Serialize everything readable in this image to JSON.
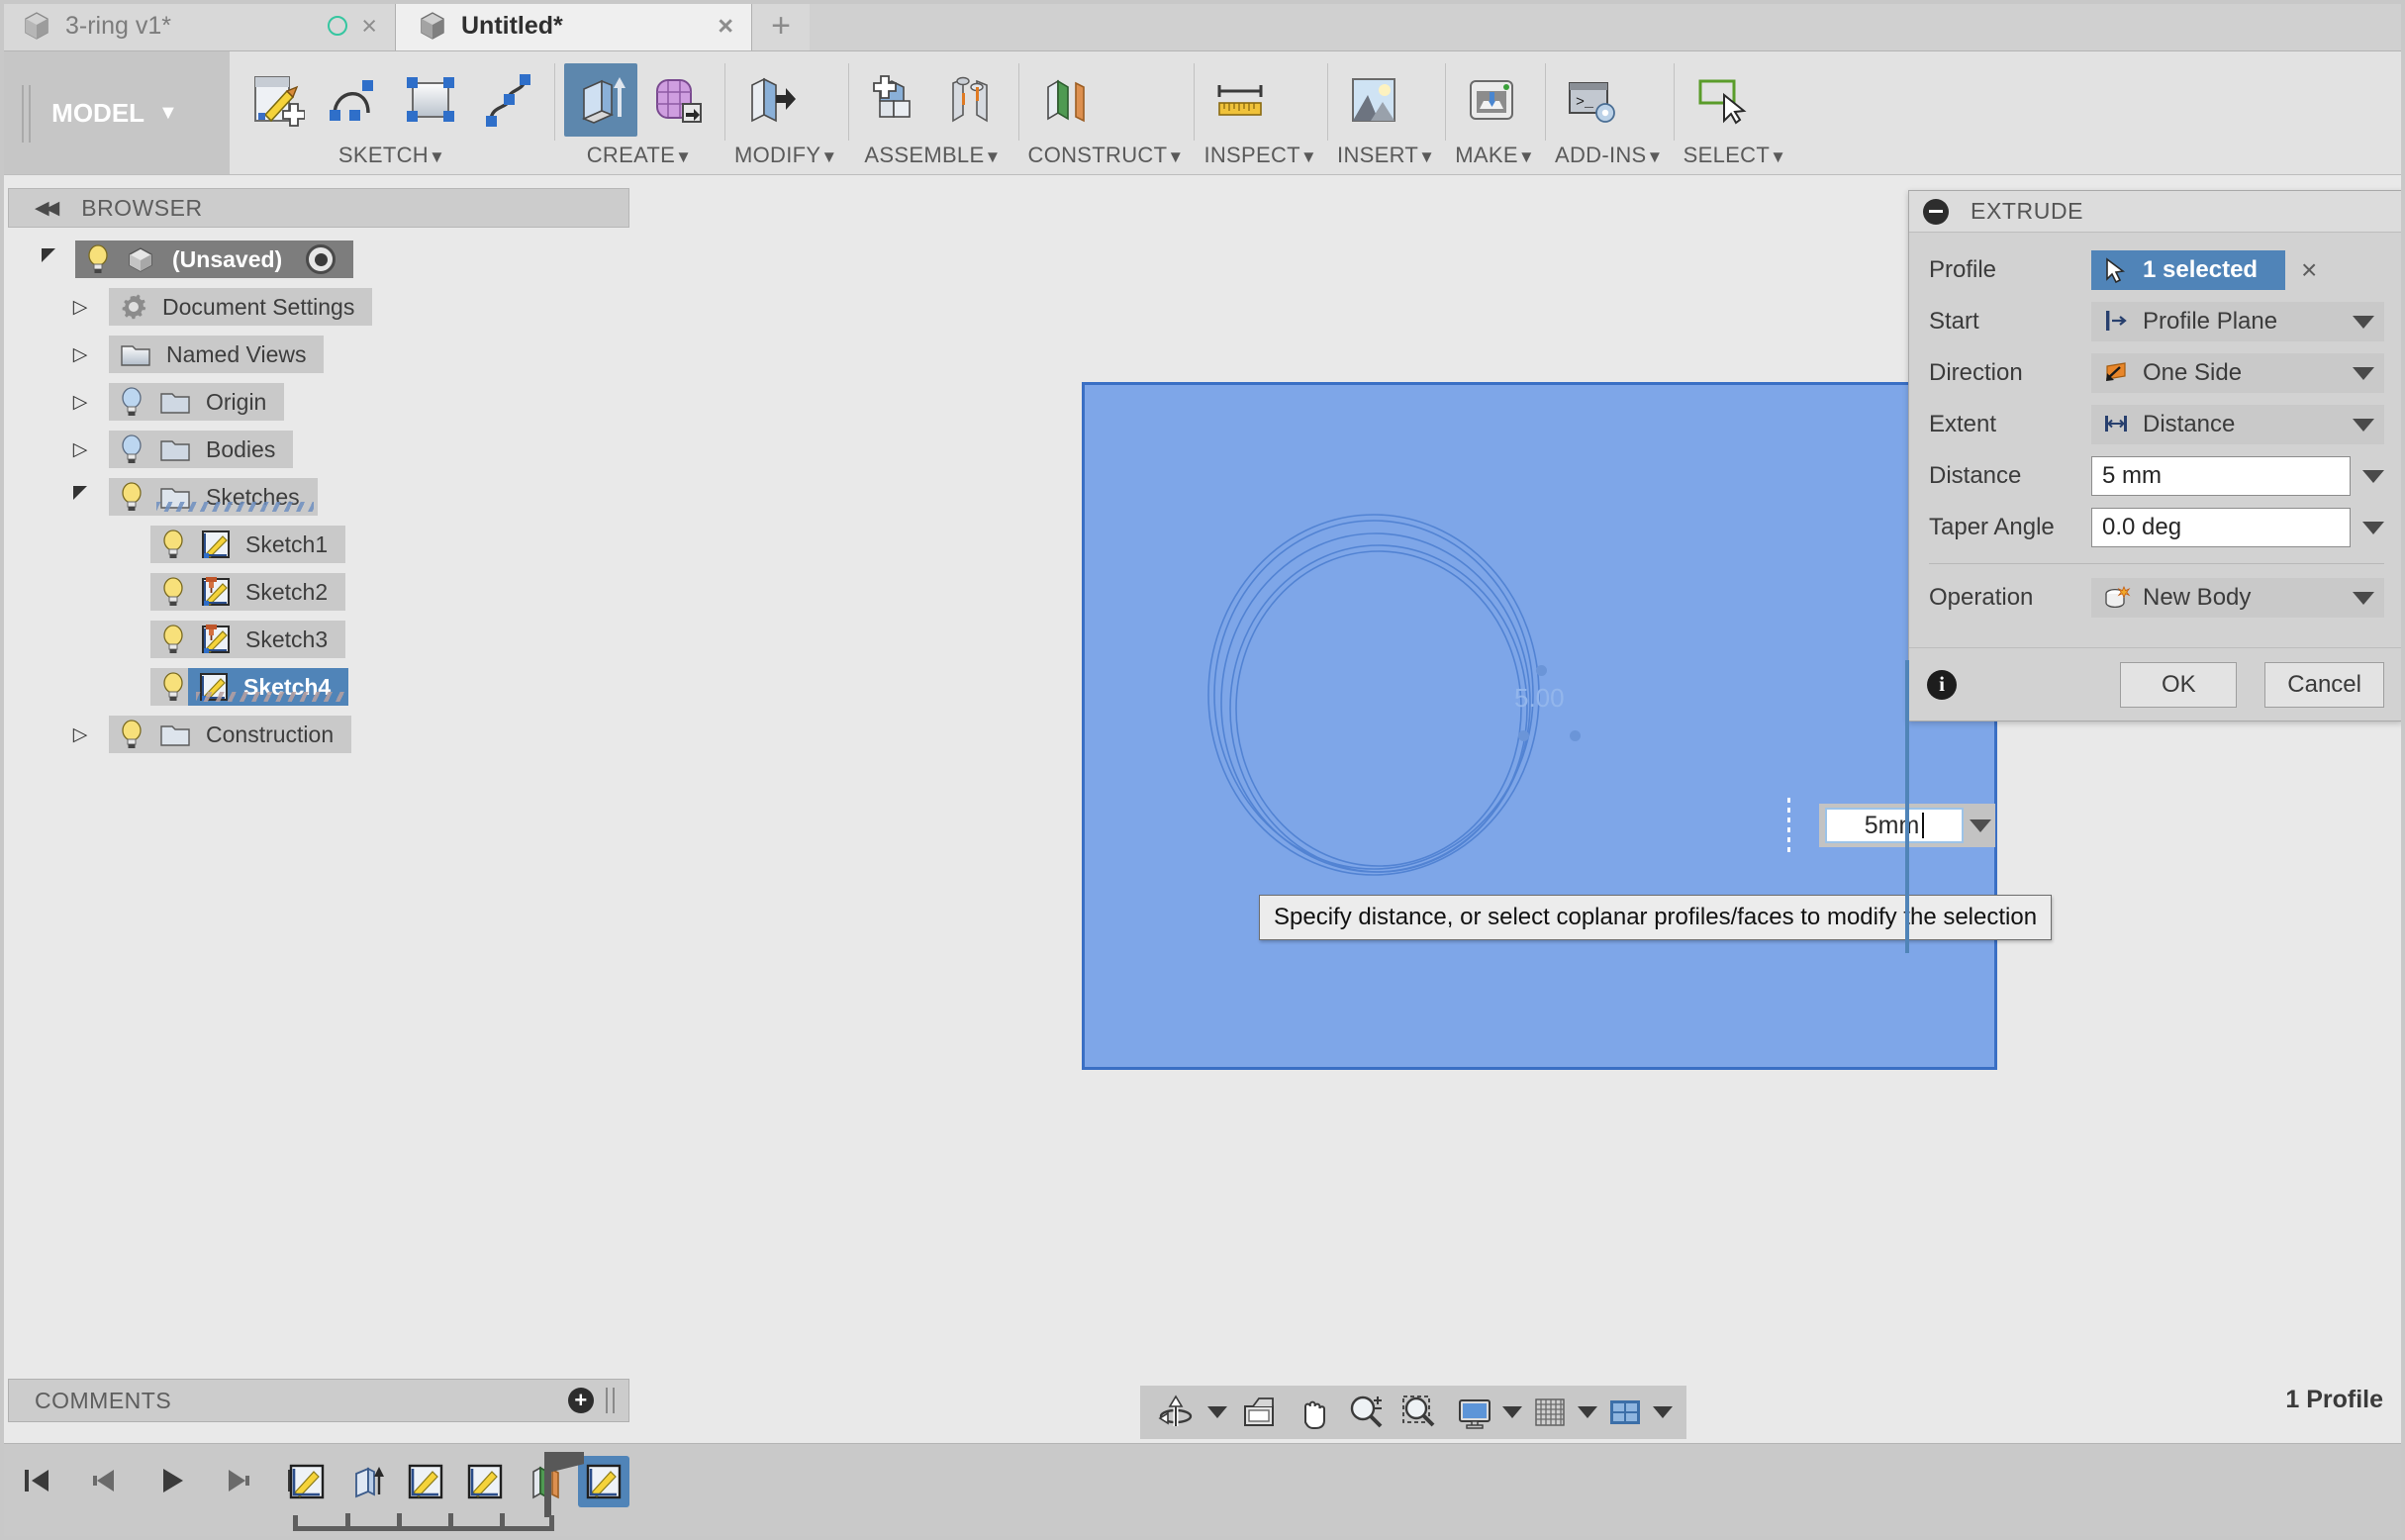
{
  "window": {
    "tabs": [
      {
        "label": "3-ring v1*",
        "active": false,
        "has_sync_dot": true,
        "close": "×"
      },
      {
        "label": "Untitled*",
        "active": true,
        "close": "×"
      }
    ],
    "new_tab_label": "+"
  },
  "ribbon": {
    "workspace": "MODEL",
    "workspace_caret": "▼",
    "groups": [
      {
        "name": "SKETCH",
        "label": "SKETCH",
        "caret": "▼",
        "buttons": [
          "create-sketch-icon",
          "arc-icon",
          "rectangle-icon",
          "spline-icon"
        ]
      },
      {
        "name": "CREATE",
        "label": "CREATE",
        "caret": "▼",
        "buttons": [
          "extrude-icon",
          "create-form-icon"
        ]
      },
      {
        "name": "MODIFY",
        "label": "MODIFY",
        "caret": "▼",
        "buttons": [
          "press-pull-icon"
        ]
      },
      {
        "name": "ASSEMBLE",
        "label": "ASSEMBLE",
        "caret": "▼",
        "buttons": [
          "new-component-icon",
          "joint-icon"
        ]
      },
      {
        "name": "CONSTRUCT",
        "label": "CONSTRUCT",
        "caret": "▼",
        "buttons": [
          "offset-plane-icon"
        ]
      },
      {
        "name": "INSPECT",
        "label": "INSPECT",
        "caret": "▼",
        "buttons": [
          "measure-icon"
        ]
      },
      {
        "name": "INSERT",
        "label": "INSERT",
        "caret": "▼",
        "buttons": [
          "insert-image-icon"
        ]
      },
      {
        "name": "MAKE",
        "label": "MAKE",
        "caret": "▼",
        "buttons": [
          "3d-print-icon"
        ]
      },
      {
        "name": "ADD-INS",
        "label": "ADD-INS",
        "caret": "▼",
        "buttons": [
          "scripts-addins-icon"
        ]
      },
      {
        "name": "SELECT",
        "label": "SELECT",
        "caret": "▼",
        "buttons": [
          "select-icon"
        ]
      }
    ]
  },
  "browser": {
    "title": "BROWSER",
    "collapse_icon": "◀◀",
    "tree": [
      {
        "label": "(Unsaved)",
        "level": 0,
        "twist": "open",
        "selected": true,
        "icons": [
          "lightbulb-icon",
          "component-cube-icon"
        ],
        "radio": true
      },
      {
        "label": "Document Settings",
        "level": 1,
        "twist": "closed",
        "icons": [
          "gear-icon"
        ]
      },
      {
        "label": "Named Views",
        "level": 1,
        "twist": "closed",
        "icons": [
          "folder-icon"
        ]
      },
      {
        "label": "Origin",
        "level": 1,
        "twist": "closed",
        "icons": [
          "lightbulb-icon",
          "folder-icon"
        ]
      },
      {
        "label": "Bodies",
        "level": 1,
        "twist": "closed",
        "icons": [
          "lightbulb-icon",
          "folder-icon"
        ]
      },
      {
        "label": "Sketches",
        "level": 1,
        "twist": "open",
        "hatched": true,
        "icons": [
          "lightbulb-icon",
          "folder-icon"
        ]
      },
      {
        "label": "Sketch1",
        "level": 2,
        "twist": "none",
        "icons": [
          "lightbulb-icon",
          "sketch-icon"
        ]
      },
      {
        "label": "Sketch2",
        "level": 2,
        "twist": "none",
        "icons": [
          "lightbulb-icon",
          "sketch-pinned-icon"
        ]
      },
      {
        "label": "Sketch3",
        "level": 2,
        "twist": "none",
        "icons": [
          "lightbulb-icon",
          "sketch-pinned-icon"
        ]
      },
      {
        "label": "Sketch4",
        "level": 2,
        "twist": "none",
        "sketch_selected": true,
        "hatched": true,
        "icons": [
          "lightbulb-icon",
          "sketch-icon"
        ]
      },
      {
        "label": "Construction",
        "level": 1,
        "twist": "closed",
        "icons": [
          "lightbulb-icon",
          "folder-icon"
        ]
      }
    ]
  },
  "extrude_dialog": {
    "title": "EXTRUDE",
    "collapse_icon": "minus-circle-icon",
    "rows": [
      {
        "label": "Profile",
        "value": "1 selected",
        "kind": "selection",
        "icon": "cursor-arrow-icon",
        "clear": "×"
      },
      {
        "label": "Start",
        "value": "Profile Plane",
        "kind": "dropdown",
        "icon": "profile-plane-icon"
      },
      {
        "label": "Direction",
        "value": "One Side",
        "kind": "dropdown",
        "icon": "one-side-icon"
      },
      {
        "label": "Extent",
        "value": "Distance",
        "kind": "dropdown",
        "icon": "distance-icon"
      },
      {
        "label": "Distance",
        "value": "5 mm",
        "kind": "textfield"
      },
      {
        "label": "Taper Angle",
        "value": "0.0 deg",
        "kind": "textfield"
      },
      {
        "label": "Operation",
        "value": "New Body",
        "kind": "dropdown",
        "icon": "new-body-icon"
      }
    ],
    "info_icon": "i",
    "ok_label": "OK",
    "cancel_label": "Cancel"
  },
  "canvas": {
    "manipulator_value": "5mm",
    "dimension_label": "5.00",
    "tooltip": "Specify distance, or select coplanar profiles/faces to modify the selection",
    "profile_fill": "#7ea6e8",
    "profile_stroke": "#3a6fc4"
  },
  "comments": {
    "title": "COMMENTS",
    "add_label": "+"
  },
  "navbar": {
    "tools": [
      "orbit-icon",
      "orbit-caret",
      "look-at-icon",
      "pan-icon",
      "zoom-icon",
      "zoom-window-icon",
      "zoom-caret"
    ],
    "display_tools": [
      "display-settings-icon",
      "display-caret",
      "grid-snap-icon",
      "grid-caret",
      "viewports-icon",
      "viewports-caret"
    ]
  },
  "status": {
    "profile_count": "1 Profile"
  },
  "timeline": {
    "playback": [
      "go-to-beginning-icon",
      "step-back-icon",
      "play-icon",
      "step-forward-icon",
      "go-to-end-icon"
    ],
    "features": [
      {
        "icon": "sketch-icon",
        "name": "sketch1-feature",
        "current": false
      },
      {
        "icon": "extrude-icon",
        "name": "extrude1-feature",
        "current": false
      },
      {
        "icon": "sketch-icon",
        "name": "sketch2-feature",
        "current": false
      },
      {
        "icon": "sketch-icon",
        "name": "sketch3-feature",
        "current": false
      },
      {
        "icon": "plane-icon",
        "name": "plane1-feature",
        "current": false
      },
      {
        "icon": "sketch-icon",
        "name": "sketch4-feature",
        "current": true
      }
    ]
  }
}
